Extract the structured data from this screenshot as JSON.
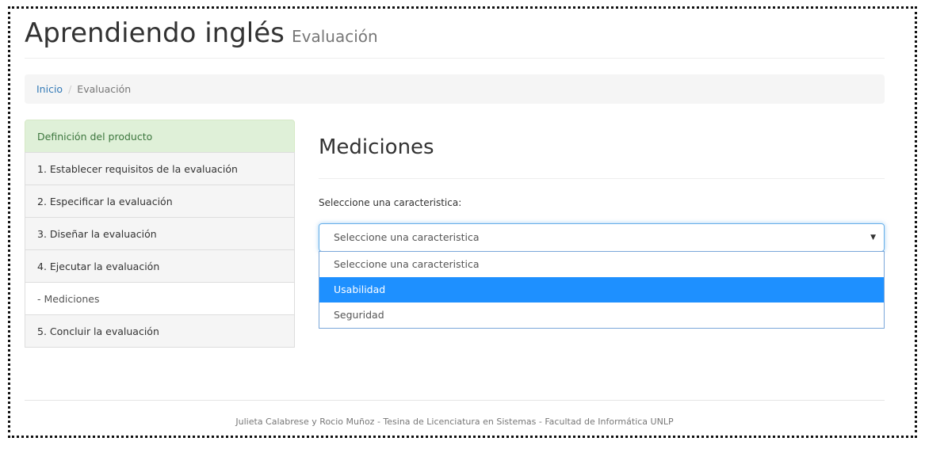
{
  "header": {
    "title": "Aprendiendo inglés",
    "subtitle": "Evaluación"
  },
  "breadcrumb": {
    "home": "Inicio",
    "separator": "/",
    "current": "Evaluación"
  },
  "sidebar": {
    "items": [
      {
        "label": "Definición del producto"
      },
      {
        "label": "1. Establecer requisitos de la evaluación"
      },
      {
        "label": "2. Especificar la evaluación"
      },
      {
        "label": "3. Diseñar la evaluación"
      },
      {
        "label": "4. Ejecutar la evaluación"
      },
      {
        "label": "- Mediciones"
      },
      {
        "label": "5. Concluir la evaluación"
      }
    ]
  },
  "main": {
    "title": "Mediciones",
    "select_label": "Seleccione una caracteristica:",
    "select_value": "Seleccione una caracteristica",
    "options": [
      {
        "label": "Seleccione una caracteristica"
      },
      {
        "label": "Usabilidad"
      },
      {
        "label": "Seguridad"
      }
    ],
    "highlighted_option": "Usabilidad"
  },
  "footer": {
    "text": "Julieta Calabrese y Rocio Muñoz - Tesina de Licenciatura en Sistemas - Facultad de Informática UNLP"
  },
  "colors": {
    "accent": "#337ab7",
    "highlight": "#1e90ff",
    "active_panel": "#dff0d8"
  }
}
